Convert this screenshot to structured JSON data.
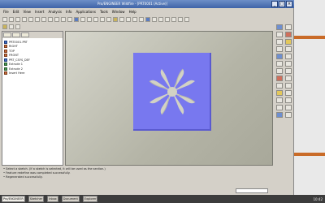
{
  "window": {
    "title": "Pro/ENGINEER Wildfire - [PRT0001 (Active)]",
    "controls": [
      "_",
      "□",
      "×"
    ]
  },
  "menubar": {
    "items": [
      "File",
      "Edit",
      "View",
      "Insert",
      "Analysis",
      "Info",
      "Applications",
      "Tools",
      "Window",
      "Help"
    ]
  },
  "sidebar": {
    "tabs": [
      "model-tree-tab",
      "folder-tab",
      "favorites-tab"
    ],
    "tree": [
      {
        "label": "PRT0001.PRT",
        "icon": "part-icon"
      },
      {
        "label": "RIGHT",
        "icon": "datum-plane-icon"
      },
      {
        "label": "TOP",
        "icon": "datum-plane-icon"
      },
      {
        "label": "FRONT",
        "icon": "datum-plane-icon"
      },
      {
        "label": "PRT_CSYS_DEF",
        "icon": "csys-icon"
      },
      {
        "label": "Extrude 1",
        "icon": "extrude-icon"
      },
      {
        "label": "Extrude 2",
        "icon": "extrude-icon"
      },
      {
        "label": "Insert Here",
        "icon": "insert-icon"
      }
    ]
  },
  "status": {
    "lines": [
      "• Select a sketch. (If a sketch is selected, it will be used as the section.)",
      "• Feature redefine was completed successfully.",
      "• Regenerated successfully."
    ]
  },
  "taskbar": {
    "items": [
      "Pro/ENGINEER",
      "Sketcher",
      "Inbox",
      "Document",
      "Explorer"
    ],
    "clock": "10:42"
  },
  "colors": {
    "part": "#7878ef",
    "background_gradient_start": "#d6d6cc",
    "accent": "#c96b28"
  }
}
